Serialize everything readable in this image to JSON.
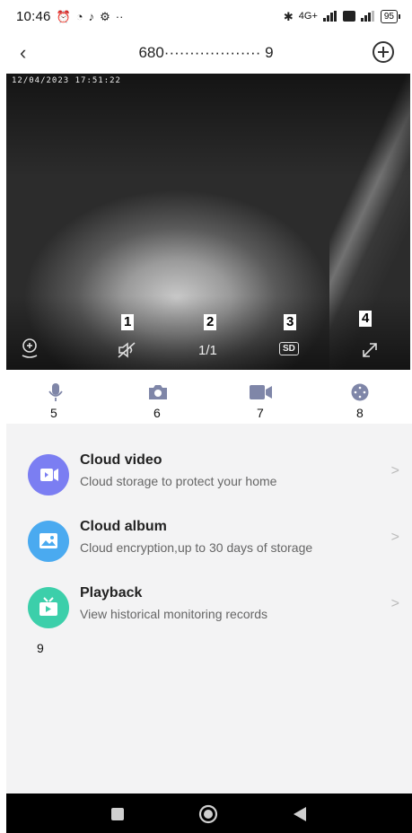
{
  "status_bar": {
    "time": "10:46",
    "extra": "··",
    "network": "4G+",
    "battery": "95"
  },
  "header": {
    "title": "680··················· 9"
  },
  "video": {
    "timestamp": "12/04/2023   17:51:22",
    "page_indicator": "1/1",
    "quality_label": "SD"
  },
  "annotations": {
    "n1": "1",
    "n2": "2",
    "n3": "3",
    "n4": "4",
    "n5": "5",
    "n6": "6",
    "n7": "7",
    "n8": "8",
    "n9": "9"
  },
  "features": {
    "items": [
      {
        "title": "Cloud video",
        "desc": "Cloud storage to protect your home",
        "icon": "cloud-video-icon",
        "color": "#7b7ef2"
      },
      {
        "title": "Cloud album",
        "desc": "Cloud encryption,up to 30 days of storage",
        "icon": "cloud-album-icon",
        "color": "#4aaaf0"
      },
      {
        "title": "Playback",
        "desc": "View historical monitoring records",
        "icon": "playback-icon",
        "color": "#3ccfaa"
      }
    ]
  },
  "colors": {
    "toolbar_icon": "#7f86a8",
    "list_bg": "#f3f3f4"
  }
}
